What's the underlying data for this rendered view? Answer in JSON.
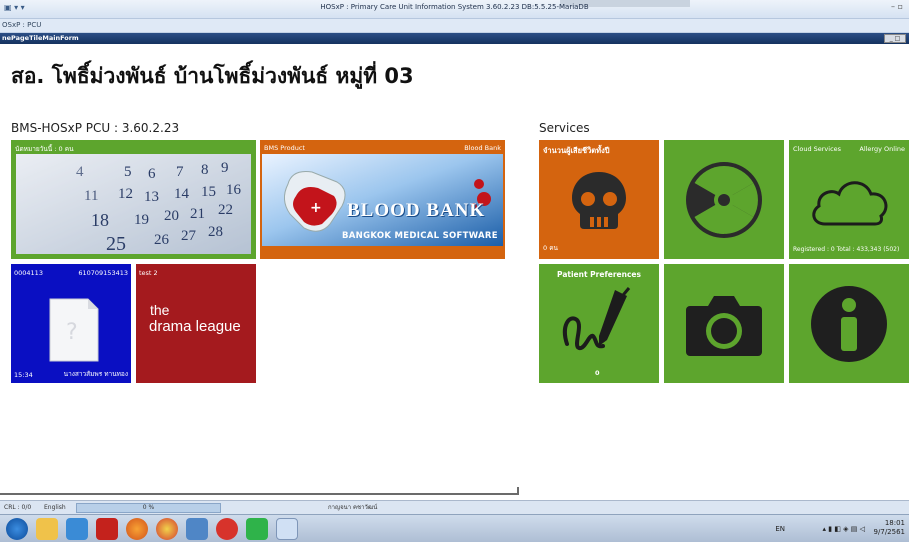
{
  "window": {
    "title": "HOSxP : Primary Care Unit Information System 3.60.2.23 DB:5.5.25-MariaDB",
    "subtitle": "OSxP : PCU",
    "form_name": "nePageTileMainForm"
  },
  "page": {
    "heading": "สอ. โพธิ์ม่วงพันธ์ บ้านโพธิ์ม่วงพันธ์ หมู่ที่ 03",
    "left_section_title": "BMS-HOSxP PCU : 3.60.2.23",
    "right_section_title": "Services"
  },
  "tiles": {
    "appointment": {
      "caption": "นัดหมายวันนี้ : 0 คน"
    },
    "blood_bank": {
      "caption_left": "BMS Product",
      "caption_right": "Blood Bank",
      "title": "BLOOD BANK",
      "subtitle": "BANGKOK MEDICAL SOFTWARE"
    },
    "patient_card": {
      "code": "0004113",
      "number": "610709153413",
      "time": "15:34",
      "name": "นางสาวสัมพร ทานทอง"
    },
    "drama": {
      "caption": "test 2",
      "line1": "the",
      "line2": "drama league"
    },
    "death": {
      "caption": "จำนวนผู้เสียชีวิตทั้งปี",
      "count": "0 คน"
    },
    "radiation": {},
    "cloud": {
      "caption_left": "Cloud Services",
      "caption_right": "Allergy Online",
      "stats": "Registered : 0    Total : 433,343 (502)"
    },
    "patient_pref": {
      "caption": "Patient Preferences",
      "count": "0"
    },
    "camera": {},
    "info": {}
  },
  "statusbar": {
    "cell1": "CRL : 0/0",
    "language": "English",
    "progress": "0 %",
    "user": "กาญจนา คชาวัฒน์"
  },
  "taskbar": {
    "lang": "EN",
    "time": "18:01",
    "date": "9/7/2561"
  },
  "colors": {
    "green": "#5da52d",
    "orange": "#d4640f",
    "blue": "#0a0fc2",
    "red": "#a41a1e"
  }
}
